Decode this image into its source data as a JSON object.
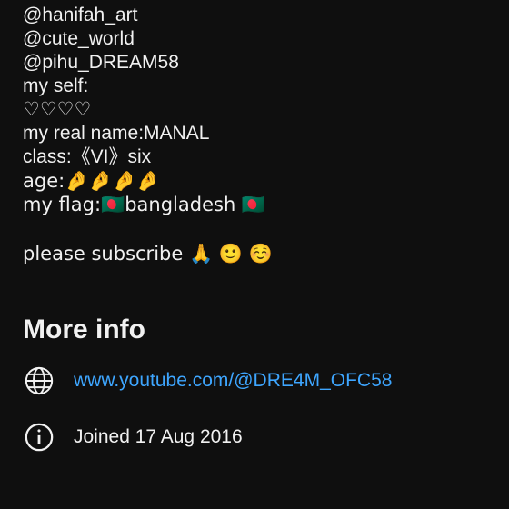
{
  "about": {
    "lines": [
      "@hanifah_art",
      "@cute_world",
      "@pihu_DREAM58",
      "my self:",
      "♡♡♡♡",
      "my real name:MANAL",
      "class:《VI》six",
      "age:🤌🤌🤌🤌",
      "my flag:🇧🇩bangladesh 🇧🇩",
      "",
      "please subscribe 🙏 🙂 ☺️"
    ]
  },
  "more_info": {
    "title": "More info",
    "link": {
      "icon": "globe-icon",
      "text": "www.youtube.com/@DRE4M_OFC58"
    },
    "joined": {
      "icon": "info-icon",
      "text": "Joined 17 Aug 2016"
    }
  },
  "colors": {
    "background": "#0f0f0f",
    "text": "#f1f1f1",
    "link": "#3ea6ff"
  }
}
